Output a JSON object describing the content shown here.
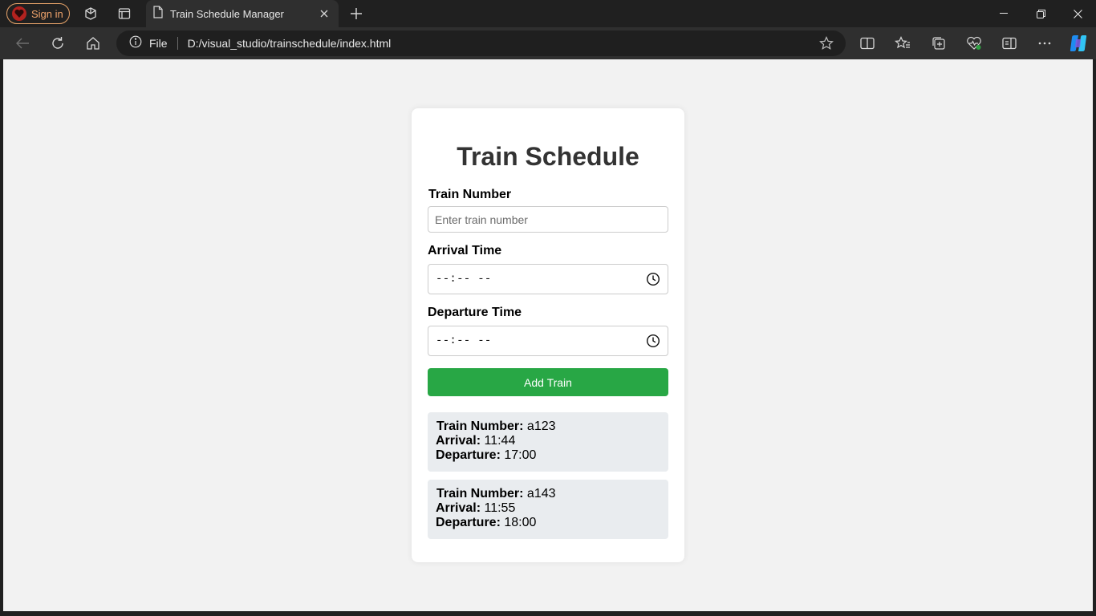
{
  "browser": {
    "sign_in_label": "Sign in",
    "tab_title": "Train Schedule Manager",
    "address_scheme": "File",
    "address_url": "D:/visual_studio/trainschedule/index.html"
  },
  "app": {
    "title": "Train Schedule",
    "train_number_label": "Train Number",
    "train_number_placeholder": "Enter train number",
    "arrival_label": "Arrival Time",
    "arrival_value": "--:-- --",
    "departure_label": "Departure Time",
    "departure_value": "--:-- --",
    "add_button_label": "Add Train",
    "trains": [
      {
        "number_label": "Train Number:",
        "number": "a123",
        "arrival_label": "Arrival:",
        "arrival": "11:44",
        "departure_label": "Departure:",
        "departure": "17:00"
      },
      {
        "number_label": "Train Number:",
        "number": "a143",
        "arrival_label": "Arrival:",
        "arrival": "11:55",
        "departure_label": "Departure:",
        "departure": "18:00"
      }
    ]
  },
  "colors": {
    "accent_button": "#28a745",
    "item_background": "#e9ecef",
    "page_background": "#f2f2f2",
    "sign_in_border": "#e8a46a"
  }
}
